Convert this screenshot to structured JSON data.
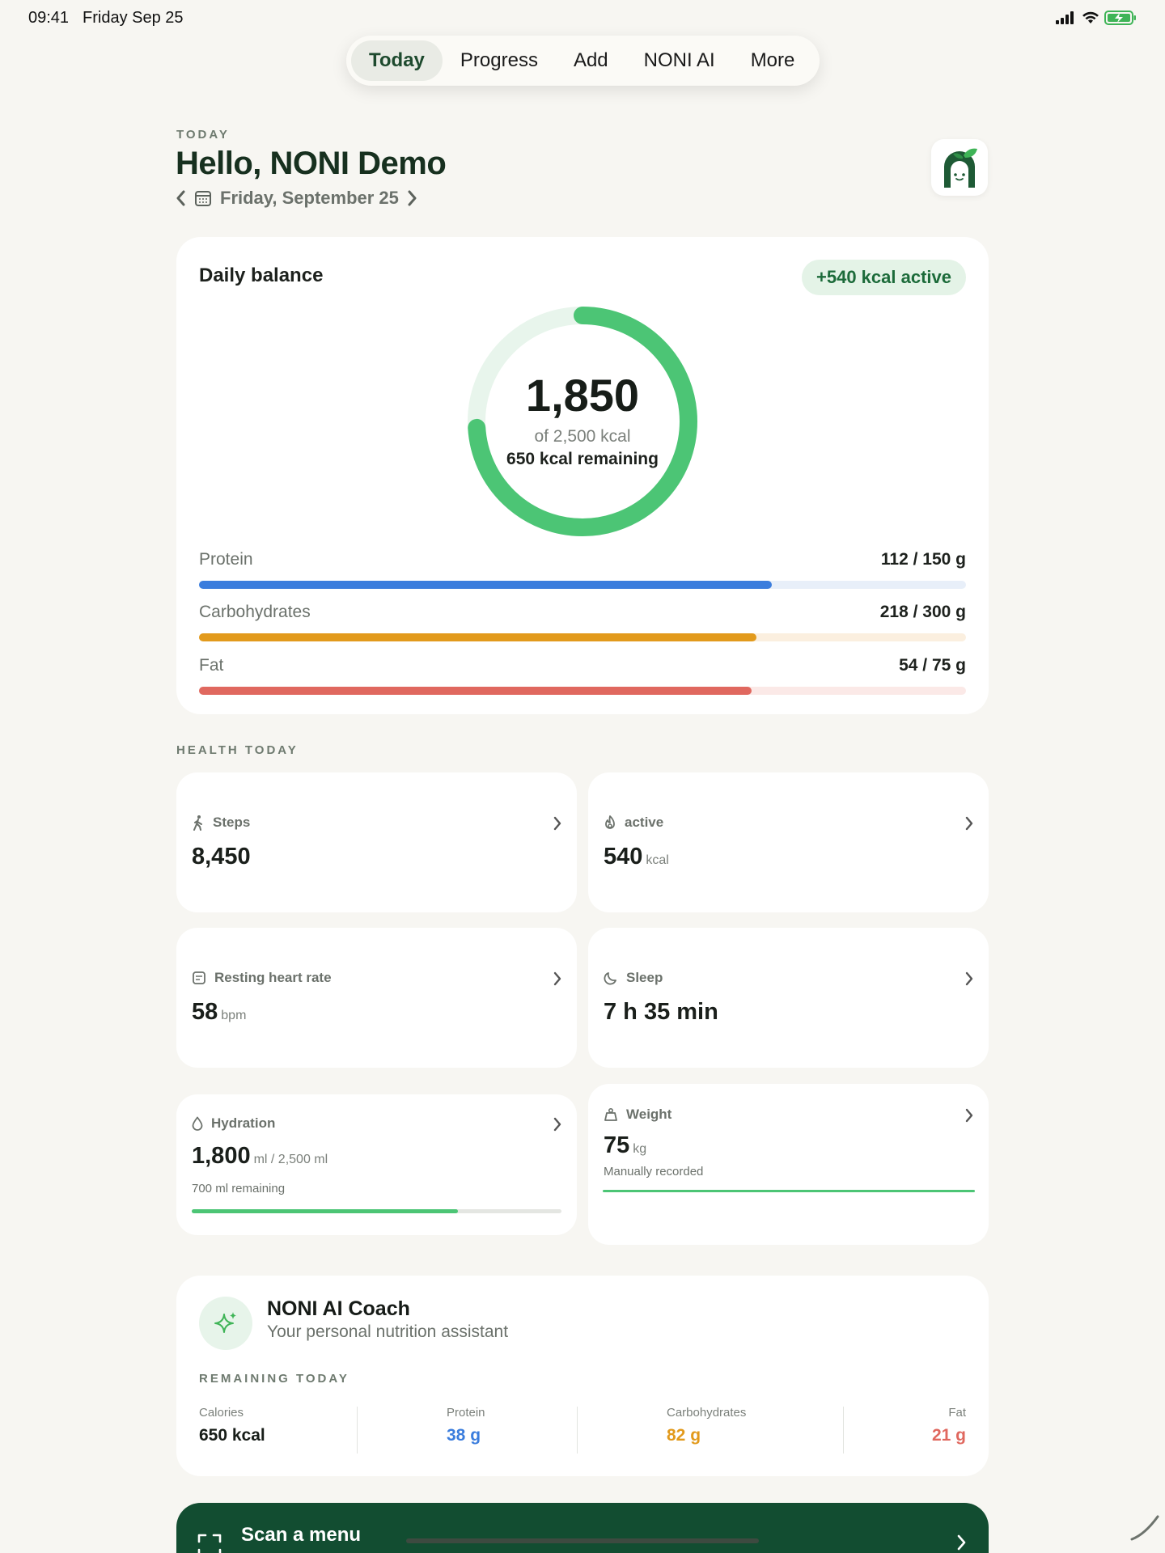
{
  "status_bar": {
    "time": "09:41",
    "date": "Friday Sep 25"
  },
  "nav": {
    "tabs": [
      "Today",
      "Progress",
      "Add",
      "NONI AI",
      "More"
    ],
    "active": "Today"
  },
  "header": {
    "eyebrow": "TODAY",
    "greeting": "Hello, NONI Demo",
    "date": "Friday, September 25"
  },
  "balance": {
    "title": "Daily balance",
    "active_badge": "+540 kcal active",
    "consumed": "1,850",
    "goal_text": "of 2,500 kcal",
    "remaining_text": "650 kcal remaining",
    "progress": 0.74,
    "accent": "#4cc575",
    "track": "#e8f5ec"
  },
  "macros": [
    {
      "name": "Protein",
      "value": "112 / 150 g",
      "progress": 0.747,
      "color": "#3b7ddd",
      "track": "#e8eff9"
    },
    {
      "name": "Carbohydrates",
      "value": "218 / 300 g",
      "progress": 0.727,
      "color": "#e29a1c",
      "track": "#fbefdf"
    },
    {
      "name": "Fat",
      "value": "54 / 75 g",
      "progress": 0.72,
      "color": "#e0685f",
      "track": "#fbe9e7"
    }
  ],
  "health": {
    "label": "HEALTH TODAY",
    "steps": {
      "label": "Steps",
      "value": "8,450"
    },
    "active": {
      "label": "active",
      "value": "540",
      "unit": "kcal"
    },
    "heart": {
      "label": "Resting heart rate",
      "value": "58",
      "unit": "bpm"
    },
    "sleep": {
      "label": "Sleep",
      "value": "7 h 35 min"
    },
    "hydration": {
      "label": "Hydration",
      "value": "1,800",
      "unit": "ml / 2,500 ml",
      "sub": "700 ml remaining",
      "progress": 0.72
    },
    "weight": {
      "label": "Weight",
      "value": "75",
      "unit": "kg",
      "sub": "Manually recorded"
    }
  },
  "coach": {
    "title": "NONI AI Coach",
    "subtitle": "Your personal nutrition assistant",
    "remaining_label": "REMAINING TODAY",
    "remaining": [
      {
        "name": "Calories",
        "value": "650 kcal",
        "color": "#171d18"
      },
      {
        "name": "Protein",
        "value": "38 g",
        "color": "#3b7ddd"
      },
      {
        "name": "Carbohydrates",
        "value": "82 g",
        "color": "#e29a1c"
      },
      {
        "name": "Fat",
        "value": "21 g",
        "color": "#e0685f"
      }
    ]
  },
  "scan": {
    "title": "Scan a menu"
  }
}
